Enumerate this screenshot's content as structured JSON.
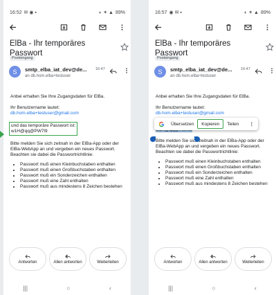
{
  "left": {
    "status": {
      "time": "16:52",
      "battery": "89%"
    },
    "subject": "ElBa - Ihr temporäres Passwort",
    "label": "Posteingang",
    "sender": {
      "avatar_letter": "S",
      "name": "smtp_elba_iat_dev@de...",
      "time": "16:47",
      "to": "an db.hom.elba+testuser"
    },
    "body": {
      "intro": "Anbei erhalten Sie Ihre Zugangsdaten für ElBa.",
      "username_label": "Ihr Benutzername lautet:",
      "username": "db.hom.elba+testuser@gmail.com",
      "password_label": "und das temporäre Passwort ist:",
      "password": "w1H@qq@PW7l9",
      "instructions": "Bitte melden Sie sich zeitnah in der ElBa-App oder der ElBa-WebApp an und vergeben ein neues Passwort.",
      "guidelines": "Beachten sie dabei die Passwortrichtlinie:",
      "rules": [
        "Passwort muß einen Kleinbuchstaben enthalten",
        "Passwort muß einen Großbuchstaben enthalten",
        "Passwort muß ein Sonderzeichen enthalten",
        "Passwort muß eine Zahl enthalten",
        "Passwort muß aus mindestens 8 Zeichen bestehen"
      ]
    }
  },
  "right": {
    "status": {
      "time": "16:57",
      "battery": "89%"
    },
    "subject": "ElBa - Ihr temporäres Passwort",
    "label": "Posteingang",
    "sender": {
      "avatar_letter": "S",
      "name": "smtp_elba_iat_dev@de...",
      "time": "16:47",
      "to": "an db.hom.elba+testuser"
    },
    "body": {
      "intro": "Anbei erhalten Sie Ihre Zugangsdaten für ElBa.",
      "username_label": "Ihr Benutzername lautet:",
      "username": "db.hom.elba+testuser@gmail.com",
      "password": "w1H@qq@PW7l9",
      "instructions": "Bitte melden Sie sich zeitnah in der ElBa-App oder der ElBa-WebApp an und vergeben ein neues Passwort.",
      "guidelines": "Beachten sie dabei die Passwortrichtlinie:",
      "rules": [
        "Passwort muß einen Kleinbuchstaben enthalten",
        "Passwort muß einen Großbuchstaben enthalten",
        "Passwort muß ein Sonderzeichen enthalten",
        "Passwort muß eine Zahl enthalten",
        "Passwort muß aus mindestens 8 Zeichen bestehen"
      ]
    },
    "popup": {
      "translate": "Übersetzen",
      "copy": "Kopieren",
      "share": "Teilen"
    }
  },
  "actions": {
    "reply": "Antworten",
    "reply_all": "Allen antworten",
    "forward": "Weiterleiten"
  },
  "colors": {
    "highlight": "#3aa34b",
    "link": "#1a73e8",
    "selection": "#9fc3e6",
    "avatar": "#6f8fe6"
  }
}
